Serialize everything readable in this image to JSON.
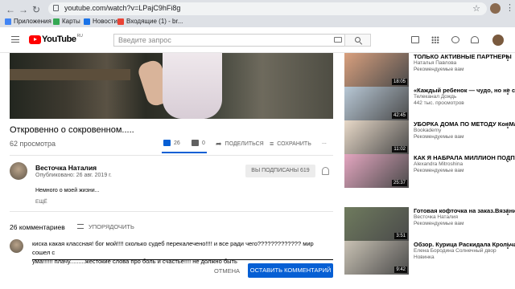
{
  "browser": {
    "url": "youtube.com/watch?v=LPajC9hFi8g",
    "bookmarks": [
      {
        "label": "Приложения",
        "color": "#4285f4"
      },
      {
        "label": "Карты",
        "color": "#34a853"
      },
      {
        "label": "Новости",
        "color": "#1a73e8"
      },
      {
        "label": "Входящие (1) - br...",
        "color": "#ea4335"
      }
    ]
  },
  "header": {
    "logo_text": "YouTube",
    "region": "RU",
    "search_placeholder": "Введите запрос"
  },
  "video": {
    "title": "Откровенно о сокровенном.....",
    "views": "62 просмотра",
    "likes": "26",
    "dislikes": "0",
    "like_ratio": 1.0,
    "share_label": "ПОДЕЛИТЬСЯ",
    "save_label": "СОХРАНИТЬ",
    "more_label": "..."
  },
  "channel": {
    "name": "Весточка Наталия",
    "published": "Опубликовано: 26 авг. 2019 г.",
    "subscribed_label": "ВЫ ПОДПИСАНЫ",
    "subscribers": "619",
    "description": "Немного о моей жизни...",
    "more_label": "ЕЩЁ"
  },
  "comments": {
    "count_label": "26 комментариев",
    "sort_label": "УПОРЯДОЧИТЬ",
    "draft_line1": "киска какая классная! бог мой!!!! сколько судеб перекалечено!!!! и все ради чего????????????? мир сошел с",
    "draft_line2": "ума!!!!!! плачу.........жестокие слова про боль и счастье!!!! не должно быть",
    "cancel_label": "ОТМЕНА",
    "submit_label": "ОСТАВИТЬ КОММЕНТАРИЙ"
  },
  "sidebar": {
    "items": [
      {
        "title": "ТОЛЬКО АКТИВНЫЕ ПАРТНЕРЫ",
        "channel": "Наталья Павлова",
        "meta": "Рекомендуемые вам",
        "duration": "18:05",
        "thumb_color": "#d9a07e"
      },
      {
        "title": "«Каждый ребенок — чудо, но не святой». Юлия...",
        "channel": "Телеканал Дождь",
        "meta": "442 тыс. просмотров",
        "duration": "42:45",
        "thumb_color": "#b8c8d6"
      },
      {
        "title": "УБОРКА ДОМА ПО МЕТОДУ КонМари: МОЙ ОПЫТ",
        "channel": "Bookademy",
        "meta": "Рекомендуемые вам",
        "duration": "11:02",
        "thumb_color": "#e8d9c8"
      },
      {
        "title": "КАК Я НАБРАЛА МИЛЛИОН ПОДПИСЧИКОВ ЗА ДВА ГОДА",
        "channel": "Alexandra Mitroshina",
        "meta": "Рекомендуемые вам",
        "duration": "25:37",
        "thumb_color": "#e4a6c0"
      },
      {
        "title": "Готовая кофточка на заказ.Вязание спицами.",
        "channel": "Весточка Наталия",
        "meta": "Рекомендуемые вам",
        "duration": "3:51",
        "thumb_color": "#6f7b5e"
      },
      {
        "title": "Обзор. Курица Раскидала Крольчат. Бройлеры. Роббе...",
        "channel": "Елена Бородина Солнечный двор",
        "meta": "Новинка",
        "duration": "9:42",
        "thumb_color": "#c9c2b4"
      }
    ]
  }
}
